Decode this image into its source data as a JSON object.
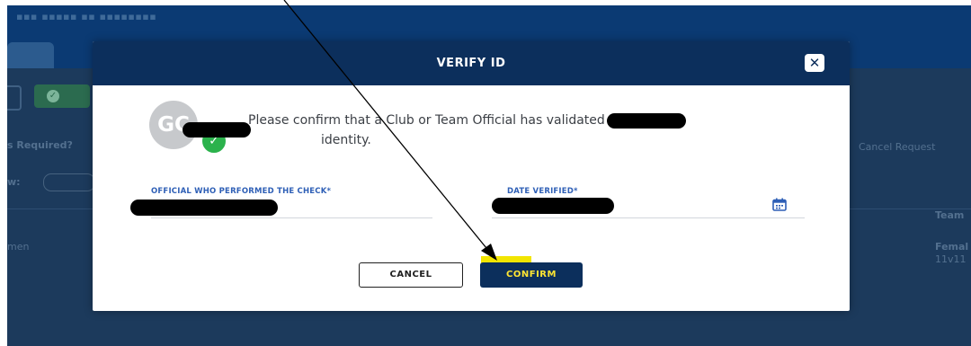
{
  "background": {
    "left_labels": [
      "s Required?",
      "w:",
      "men"
    ],
    "right_labels": [
      "Cancel Request",
      "Team",
      "Femal",
      "11v11"
    ]
  },
  "modal": {
    "title": "VERIFY ID",
    "close_icon": "x-icon",
    "avatar_initials": "GC",
    "message_part1": "Please confirm that a Club or Team Official has validated",
    "message_part2": "identity.",
    "fields": {
      "official_label": "OFFICIAL WHO PERFORMED THE CHECK*",
      "date_label": "DATE VERIFIED*"
    },
    "buttons": {
      "cancel": "CANCEL",
      "confirm": "CONFIRM"
    }
  },
  "colors": {
    "header_navy": "#0c2f5c",
    "confirm_text_yellow": "#ffe533",
    "verified_green": "#2bb24c",
    "field_label_blue": "#2e5fb6"
  }
}
